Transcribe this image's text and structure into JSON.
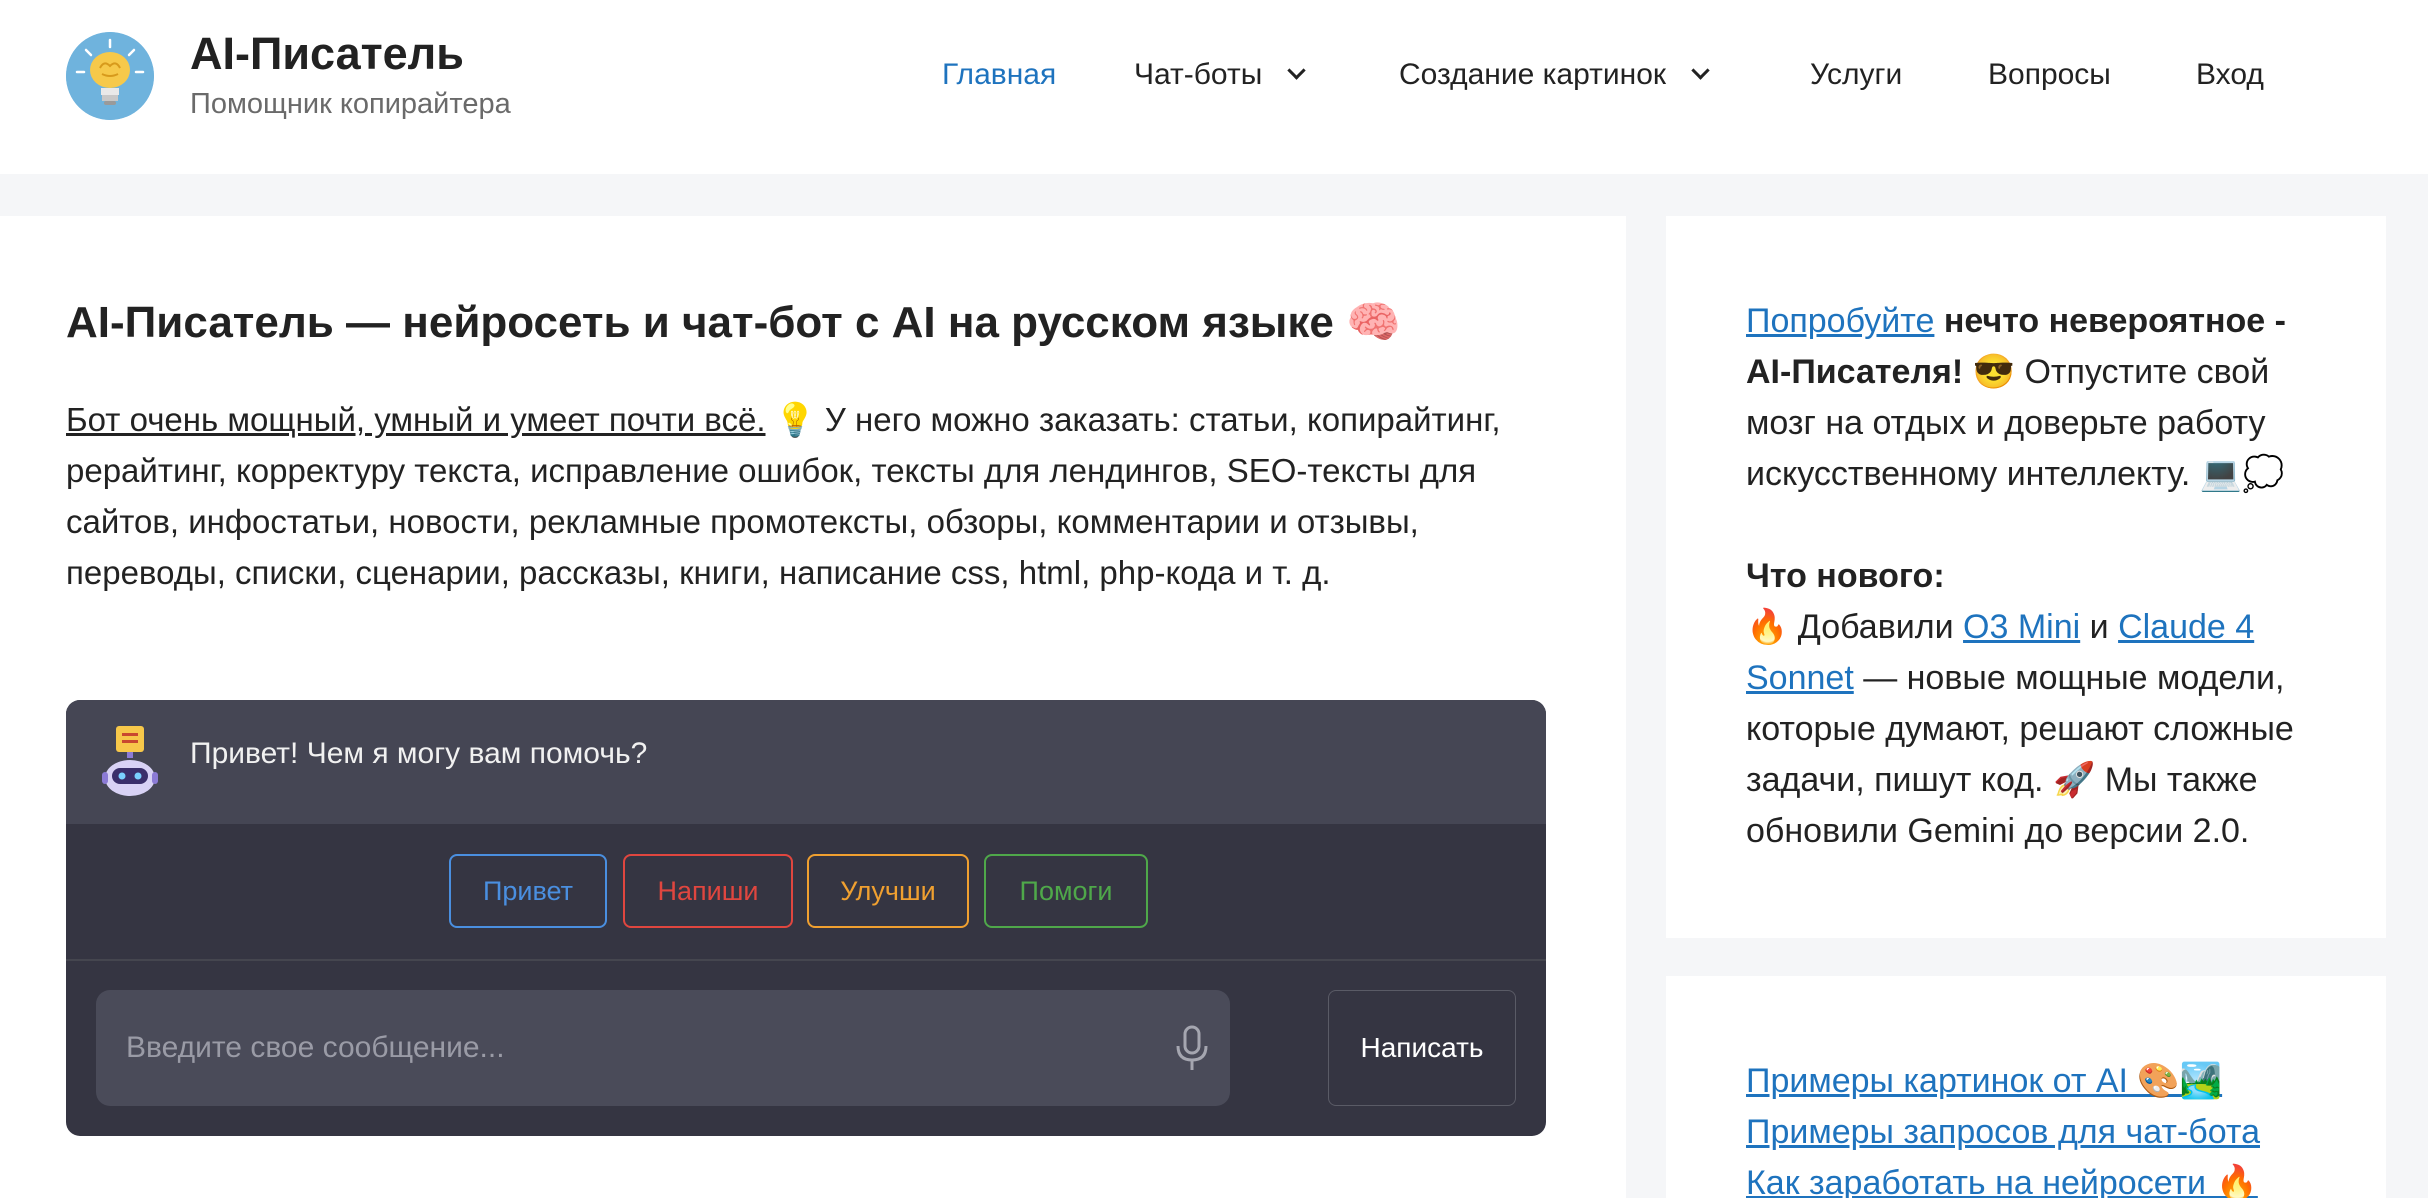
{
  "header": {
    "title": "AI-Писатель",
    "tagline": "Помощник копирайтера",
    "logo_icon": "lightbulb-brain-icon"
  },
  "nav": {
    "items": [
      {
        "label": "Главная",
        "active": true
      },
      {
        "label": "Чат-боты",
        "dropdown": true
      },
      {
        "label": "Создание картинок",
        "dropdown": true
      },
      {
        "label": "Услуги"
      },
      {
        "label": "Вопросы"
      },
      {
        "label": "Вход"
      }
    ]
  },
  "main": {
    "heading": "AI-Писатель — нейросеть и чат-бот с AI на русском языке 🧠",
    "intro_lead": "Бот очень мощный, умный и умеет почти всё.",
    "intro_rest": " 💡 У него можно заказать: статьи, копирайтинг, рерайтинг, корректуру текста, исправление ошибок, тексты для лендингов, SEO-тексты для сайтов, инфостатьи, новости, рекламные промотексты, обзоры, комментарии и отзывы, переводы, списки, сценарии, рассказы, книги, написание css, html, php-кода и т. д."
  },
  "chat": {
    "greeting": "Привет! Чем я могу вам помочь?",
    "quick_replies": [
      {
        "label": "Привет",
        "color": "#4a8fe0"
      },
      {
        "label": "Напиши",
        "color": "#e0463f"
      },
      {
        "label": "Улучши",
        "color": "#f0a030"
      },
      {
        "label": "Помоги",
        "color": "#4fa84a"
      }
    ],
    "input_placeholder": "Введите свое сообщение...",
    "send_label": "Написать",
    "avatar_icon": "robot-icon",
    "mic_icon": "microphone-icon"
  },
  "sidebar": {
    "promo": {
      "link": "Попробуйте",
      "bold": " нечто невероятное - AI-Писателя!",
      "text": " 😎 Отпустите свой мозг на отдых и доверьте работу искусственному интеллекту. 💻💭"
    },
    "news": {
      "heading": "Что нового:",
      "pre": "🔥 Добавили ",
      "link1": "O3 Mini",
      "mid": " и ",
      "link2": "Claude 4 Sonnet",
      "post": " — новые мощные модели, которые думают, решают сложные задачи, пишут код. 🚀 Мы также обновили Gemini до версии 2.0."
    },
    "links": [
      "Примеры картинок от AI 🎨🏞️",
      "Примеры запросов для чат-бота",
      "Как заработать на нейросети 🔥"
    ]
  },
  "colors": {
    "accent": "#1e73be",
    "chat_bg": "#353542",
    "chat_header_bg": "#454654"
  }
}
